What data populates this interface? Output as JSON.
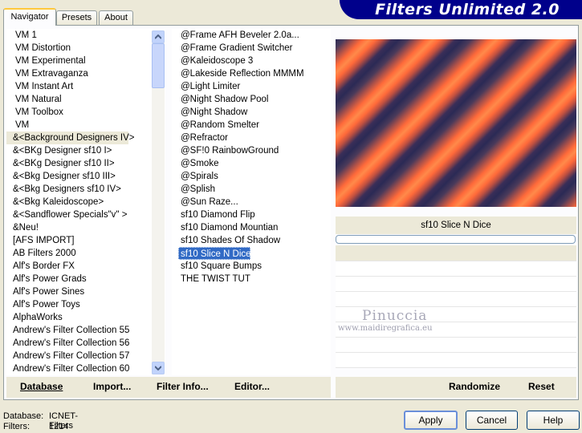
{
  "tabs": [
    "Navigator",
    "Presets",
    "About"
  ],
  "title": "Filters Unlimited 2.0",
  "categories": [
    "VM 1",
    "VM Distortion",
    "VM Experimental",
    "VM Extravaganza",
    "VM Instant Art",
    "VM Natural",
    "VM Toolbox",
    "VM",
    "&<Background Designers IV>",
    "&<BKg Designer sf10 I>",
    "&<BKg Designer sf10 II>",
    "&<Bkg Designer sf10 III>",
    "&<Bkg Designers sf10 IV>",
    "&<Bkg Kaleidoscope>",
    "&<Sandflower Specials\"v\" >",
    "&Neu!",
    "[AFS IMPORT]",
    "AB Filters 2000",
    "Alf's Border FX",
    "Alf's Power Grads",
    "Alf's Power Sines",
    "Alf's Power Toys",
    "AlphaWorks",
    "Andrew's Filter Collection 55",
    "Andrew's Filter Collection 56",
    "Andrew's Filter Collection 57",
    "Andrew's Filter Collection 60"
  ],
  "filters": [
    "@Frame AFH Beveler 2.0a...",
    "@Frame Gradient Switcher",
    "@Kaleidoscope 3",
    "@Lakeside Reflection MMMM",
    "@Light Limiter",
    "@Night Shadow Pool",
    "@Night Shadow",
    "@Random Smelter",
    "@Refractor",
    "@SF!0 RainbowGround",
    "@Smoke",
    "@Spirals",
    "@Splish",
    "@Sun Raze...",
    "sf10 Diamond Flip",
    "sf10 Diamond Mountian",
    "sf10 Shades Of Shadow",
    "sf10 Slice N Dice",
    "sf10 Square Bumps",
    "THE TWIST TUT"
  ],
  "selected_filter": "sf10 Slice N Dice",
  "watermark": {
    "line1": "Pinuccia",
    "line2": "www.maidiregrafica.eu"
  },
  "bottom_links": {
    "database": "Database",
    "import": "Import...",
    "filter_info": "Filter Info...",
    "editor": "Editor...",
    "randomize": "Randomize",
    "reset": "Reset"
  },
  "status": {
    "db_label": "Database:",
    "db_value": "ICNET-Filters",
    "filters_label": "Filters:",
    "filters_value": "1214"
  },
  "buttons": {
    "apply": "Apply",
    "cancel": "Cancel",
    "help": "Help"
  }
}
